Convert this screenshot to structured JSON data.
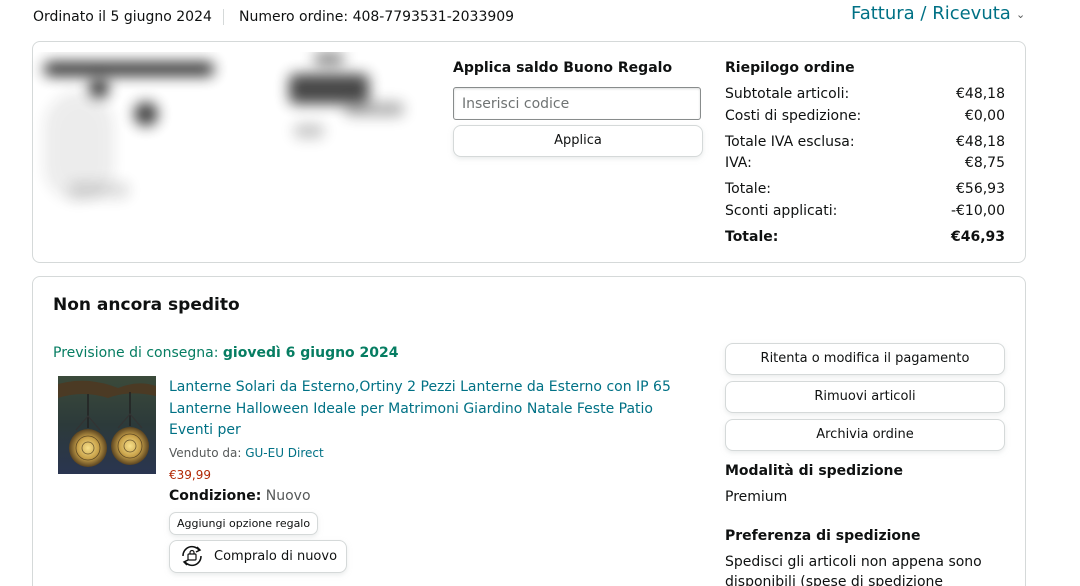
{
  "header": {
    "order_date": "Ordinato il 5 giugno 2024",
    "order_number": "Numero ordine: 408-7793531-2033909",
    "invoice_label": "Fattura / Ricevuta"
  },
  "gift_card": {
    "title": "Applica saldo Buono Regalo",
    "placeholder": "Inserisci codice",
    "apply_label": "Applica"
  },
  "summary": {
    "title": "Riepilogo ordine",
    "rows": [
      {
        "label": "Subtotale articoli:",
        "value": "€48,18"
      },
      {
        "label": "Costi di spedizione:",
        "value": "€0,00"
      },
      {
        "label": "Totale IVA esclusa:",
        "value": "€48,18"
      },
      {
        "label": "IVA:",
        "value": "€8,75"
      },
      {
        "label": "Totale:",
        "value": "€56,93"
      },
      {
        "label": "Sconti applicati:",
        "value": "-€10,00"
      },
      {
        "label": "Totale:",
        "value": "€46,93"
      }
    ]
  },
  "shipment": {
    "status": "Non ancora spedito",
    "delivery_prefix": "Previsione di consegna:",
    "delivery_date": "giovedì 6 giugno 2024",
    "product": {
      "title": "Lanterne Solari da Esterno,Ortiny 2 Pezzi Lanterne da Esterno con IP 65 Lanterne Halloween Ideale per Matrimoni Giardino Natale Feste Patio Eventi per",
      "seller_prefix": "Venduto da:",
      "seller_name": "GU-EU Direct",
      "price": "€39,99",
      "condition_label": "Condizione:",
      "condition_value": "Nuovo",
      "gift_option_label": "Aggiungi opzione regalo",
      "buy_again_label": "Compralo di nuovo"
    },
    "actions": [
      "Ritenta o modifica il pagamento",
      "Rimuovi articoli",
      "Archivia ordine"
    ],
    "shipping_mode_label": "Modalità di spedizione",
    "shipping_mode_value": "Premium",
    "shipping_pref_label": "Preferenza di spedizione",
    "shipping_pref_value": "Spedisci gli articoli non appena sono disponibili (spese di spedizione"
  }
}
